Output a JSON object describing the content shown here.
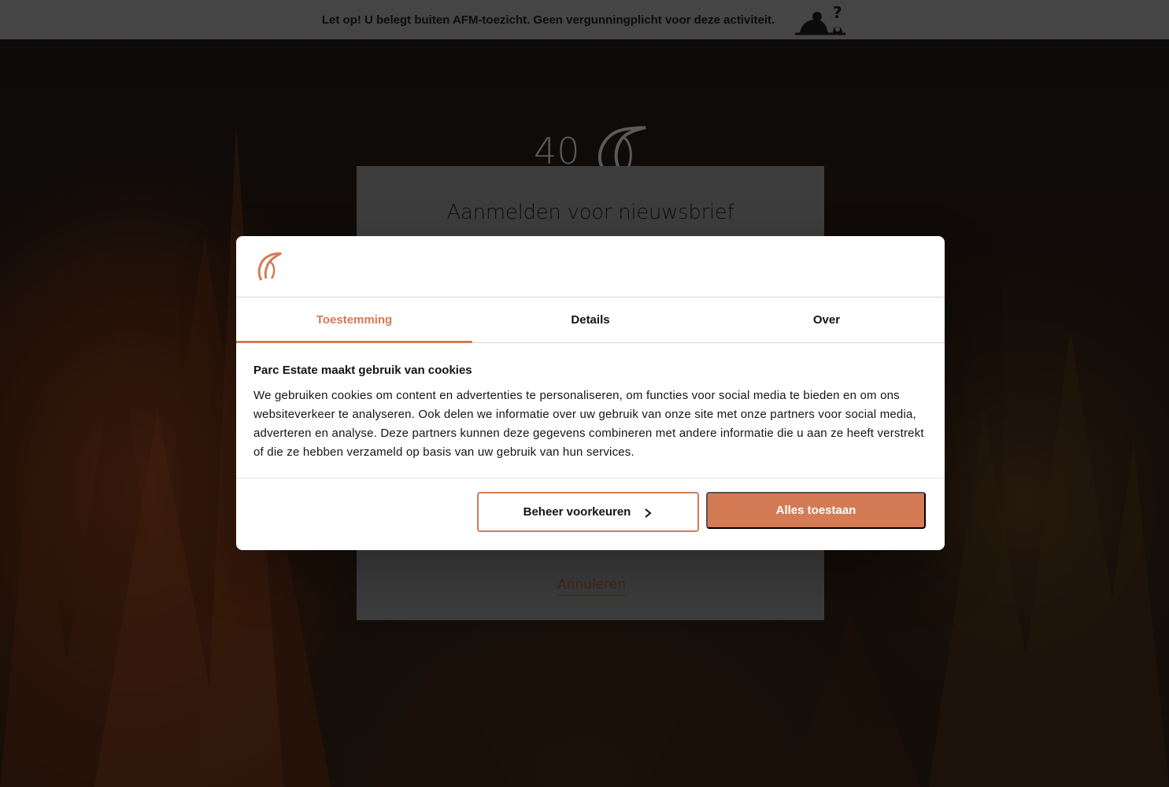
{
  "banner": {
    "text": "Let op! U belegt buiten AFM-toezicht. Geen vergunningplicht voor deze activiteit.",
    "icon": "afm-warning-icon"
  },
  "page": {
    "logo_text": "40",
    "card_title": "Aanmelden voor nieuwsbrief",
    "cancel_label": "Annuleren"
  },
  "cookie_dialog": {
    "logo": "bird-logo-icon",
    "tabs": [
      {
        "label": "Toestemming",
        "active": true
      },
      {
        "label": "Details",
        "active": false
      },
      {
        "label": "Over",
        "active": false
      }
    ],
    "heading": "Parc Estate maakt gebruik van cookies",
    "body": "We gebruiken cookies om content en advertenties te personaliseren, om functies voor social media te bieden en om ons websiteverkeer te analyseren. Ook delen we informatie over uw gebruik van onze site met onze partners voor social media, adverteren en analyse. Deze partners kunnen deze gegevens combineren met andere informatie die u aan ze heeft verstrekt of die ze hebben verzameld op basis van uw gebruik van hun services.",
    "manage_button": "Beheer voorkeuren",
    "allow_button": "Alles toestaan"
  },
  "colors": {
    "accent": "#d47b55",
    "banner_bg": "#6b6b6b",
    "text": "#141414"
  }
}
